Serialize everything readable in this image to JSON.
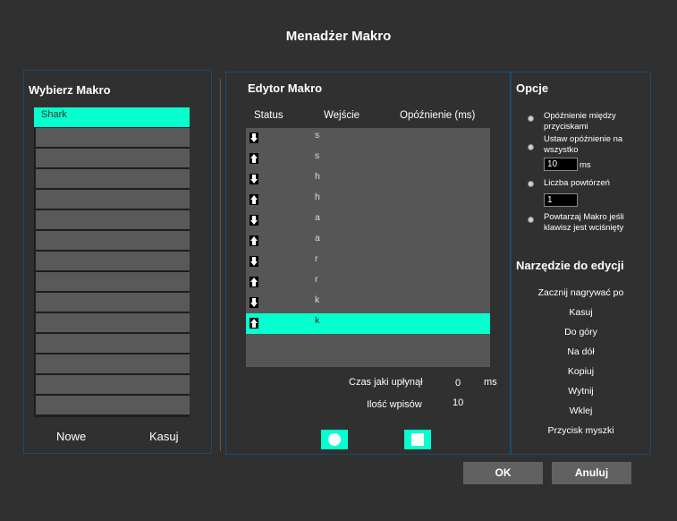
{
  "window": {
    "title": "Menadżer Makro"
  },
  "macros": {
    "heading": "Wybierz Makro",
    "items": [
      "Shark"
    ],
    "new_label": "Nowe",
    "delete_label": "Kasuj"
  },
  "editor": {
    "heading": "Edytor Makro",
    "columns": [
      "Status",
      "Wejście",
      "Opóźnienie (ms)"
    ],
    "rows": [
      {
        "status": "down-arrow-icon",
        "key": "s"
      },
      {
        "status": "up-arrow-icon",
        "key": "s"
      },
      {
        "status": "down-arrow-icon",
        "key": "h"
      },
      {
        "status": "up-arrow-icon",
        "key": "h"
      },
      {
        "status": "down-arrow-icon",
        "key": "a"
      },
      {
        "status": "up-arrow-icon",
        "key": "a"
      },
      {
        "status": "down-arrow-icon",
        "key": "r"
      },
      {
        "status": "up-arrow-icon",
        "key": "r"
      },
      {
        "status": "down-arrow-icon",
        "key": "k"
      },
      {
        "status": "up-arrow-icon",
        "key": "k",
        "selected": true
      }
    ],
    "elapsed_label": "Czas jaki upłynął",
    "elapsed_value": "0",
    "elapsed_unit": "ms",
    "count_label": "Ilość wpisów",
    "count_value": "10"
  },
  "options": {
    "heading": "Opcje",
    "delay_between": "Opóźnienie między przyciskami",
    "set_delay_all": "Ustaw opóźnienie na wszystko",
    "delay_value": "10",
    "delay_unit": "ms",
    "repeat_count": "Liczba powtórzeń",
    "repeat_value": "1",
    "repeat_while_pressed": "Powtarzaj Makro jeśli klawisz jest wciśnięty"
  },
  "tools": {
    "heading": "Narzędzie do edycji",
    "items": [
      "Zacznij nagrywać po",
      "Kasuj",
      "Do góry",
      "Na dół",
      "Kopiuj",
      "Wytnij",
      "Wklej",
      "Przycisk myszki"
    ]
  },
  "footer": {
    "ok_label": "OK",
    "cancel_label": "Anuluj"
  },
  "colors": {
    "accent": "#05ffcf",
    "background": "#303030",
    "panel_border": "#1d4a6e"
  }
}
